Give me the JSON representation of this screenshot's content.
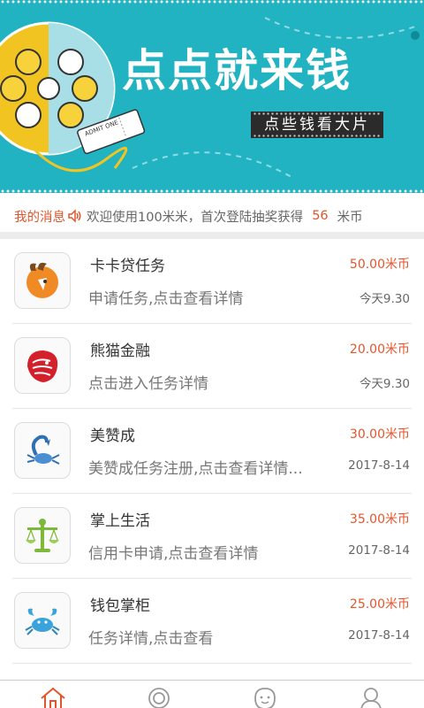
{
  "banner": {
    "title": "点点就来钱",
    "subtitle": "点些钱看大片",
    "ticket_text": "ADMIT ONE",
    "colors": {
      "background": "#22b3c2",
      "reel": "#f2c421"
    }
  },
  "notice": {
    "label": "我的消息",
    "icon": "speaker-icon",
    "text": "欢迎使用100米米，首次登陆抽奖获得",
    "amount": "56",
    "unit": "米币"
  },
  "tasks": [
    {
      "name": "卡卡贷任务",
      "desc": "申请任务,点击查看详情",
      "amount": "50.00米币",
      "date": "今天9.30",
      "icon": "goat-logo-icon"
    },
    {
      "name": "熊猫金融",
      "desc": "点击进入任务详情",
      "amount": "20.00米币",
      "date": "今天9.30",
      "icon": "lion-logo-icon"
    },
    {
      "name": "美赞成",
      "desc": "美赞成任务注册,点击查看详情...",
      "amount": "30.00米币",
      "date": "2017-8-14",
      "icon": "scorpion-logo-icon"
    },
    {
      "name": "掌上生活",
      "desc": "信用卡申请,点击查看详情",
      "amount": "35.00米币",
      "date": "2017-8-14",
      "icon": "libra-logo-icon"
    },
    {
      "name": "钱包掌柜",
      "desc": "任务详情,点击查看",
      "amount": "25.00米币",
      "date": "2017-8-14",
      "icon": "crab-logo-icon"
    }
  ],
  "tabbar": {
    "tabs": [
      {
        "icon": "home-icon",
        "active": true
      },
      {
        "icon": "discover-icon",
        "active": false
      },
      {
        "icon": "face-icon",
        "active": false
      },
      {
        "icon": "profile-icon",
        "active": false
      }
    ],
    "colors": {
      "active": "#e2552b",
      "inactive": "#999999"
    }
  }
}
